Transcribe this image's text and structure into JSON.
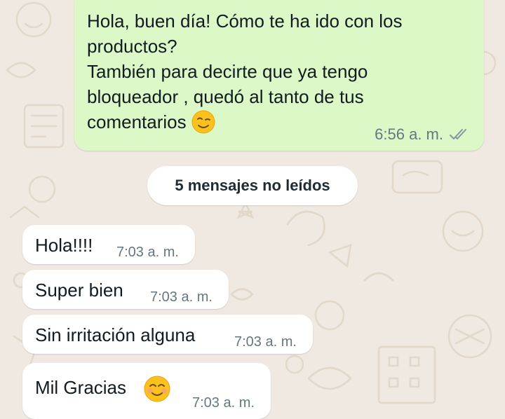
{
  "outgoing_message": {
    "lines": [
      "Hola, buen día! Cómo te ha ido con los",
      "productos?",
      "También para decirte que ya tengo",
      "bloqueador , quedó al tanto de tus",
      "comentarios"
    ],
    "emoji": "wink-smile-emoji",
    "time": "6:56 a. m.",
    "status_icon": "double-check-read-icon"
  },
  "unread_divider": {
    "label": "5 mensajes no leídos"
  },
  "incoming_messages": [
    {
      "text": "Hola!!!!",
      "time": "7:03 a. m."
    },
    {
      "text": "Super bien",
      "time": "7:03 a. m."
    },
    {
      "text": "Sin irritación alguna",
      "time": "7:03 a. m."
    },
    {
      "text": "Mil Gracias",
      "time": "7:03 a. m.",
      "emoji": "smiling-blush-emoji"
    }
  ],
  "colors": {
    "outgoing_bubble": "#dcf8c6",
    "incoming_bubble": "#ffffff",
    "chat_background": "#efe9e1"
  }
}
